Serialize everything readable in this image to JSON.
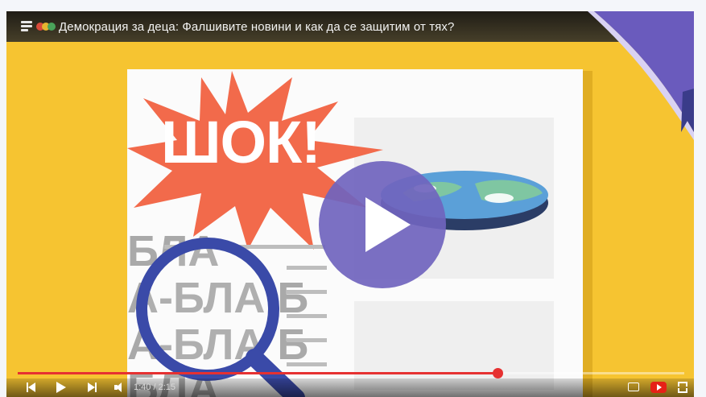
{
  "video": {
    "title": "Демокрация за деца: Фалшивите новини и как да се защитим от тях?",
    "thumbnail": {
      "burst_text": "ШОК!",
      "bla_lines": [
        "БЛА",
        "А-БЛА Б",
        "А-БЛА Б",
        "БЛА"
      ]
    }
  },
  "player": {
    "progress_fraction": 0.72,
    "time_display": "1:40 / 2:15",
    "icons": [
      "playlist-icon",
      "prev-icon",
      "play-icon",
      "next-icon",
      "volume-icon",
      "subtitles-icon",
      "youtube-icon",
      "fullscreen-icon",
      "play-button-icon"
    ]
  },
  "colors": {
    "background": "#f6c431",
    "burst": "#f26a4b",
    "play_button": "#7064be",
    "ribbon": "#6a5bbd",
    "magnifier": "#3a4aa8",
    "progress": "#e63131"
  }
}
